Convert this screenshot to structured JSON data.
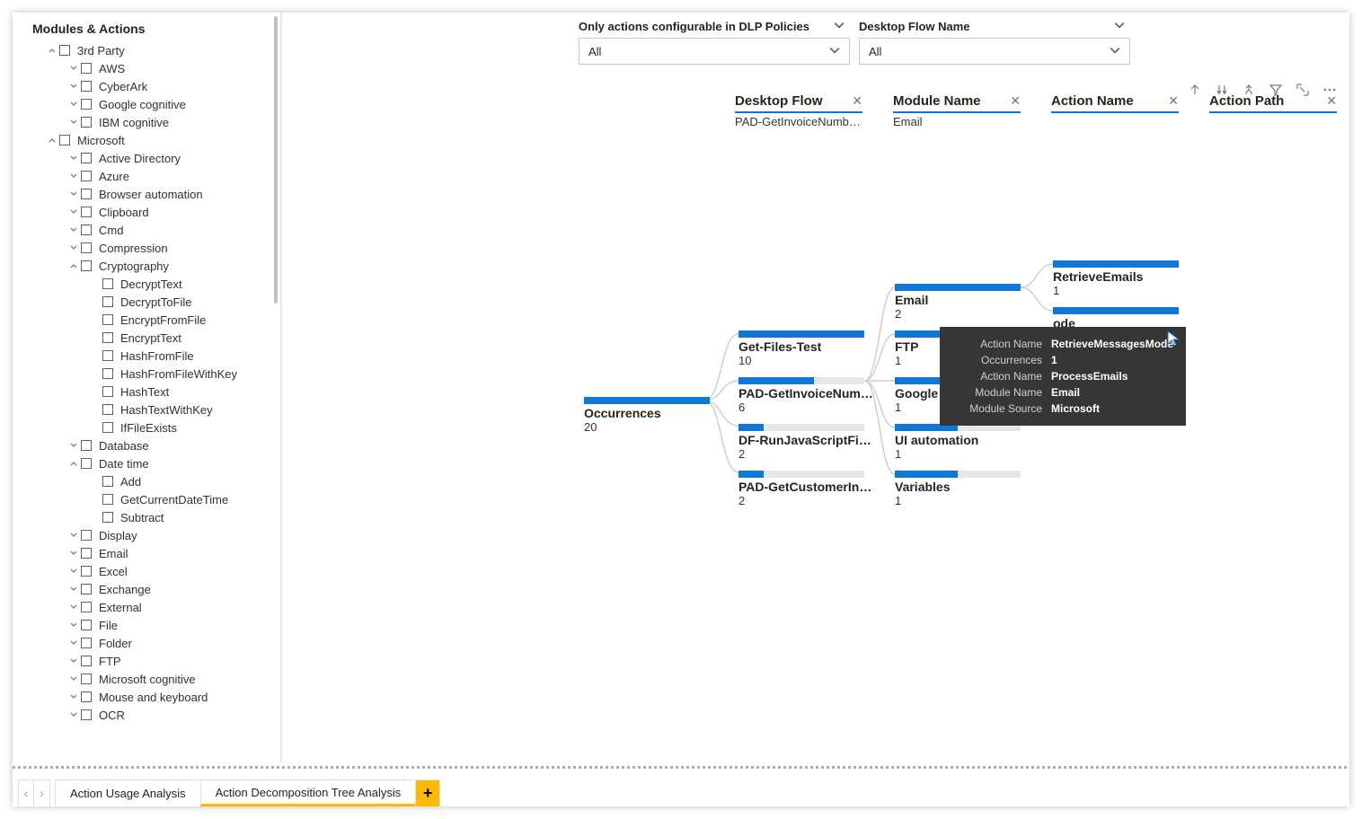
{
  "panel_title": "Modules & Actions",
  "tree": [
    {
      "lvl": 0,
      "exp": "open",
      "label": "3rd Party"
    },
    {
      "lvl": 1,
      "exp": "closed",
      "label": "AWS"
    },
    {
      "lvl": 1,
      "exp": "closed",
      "label": "CyberArk"
    },
    {
      "lvl": 1,
      "exp": "closed",
      "label": "Google cognitive"
    },
    {
      "lvl": 1,
      "exp": "closed",
      "label": "IBM cognitive"
    },
    {
      "lvl": 0,
      "exp": "open",
      "label": "Microsoft"
    },
    {
      "lvl": 1,
      "exp": "closed",
      "label": "Active Directory"
    },
    {
      "lvl": 1,
      "exp": "closed",
      "label": "Azure"
    },
    {
      "lvl": 1,
      "exp": "closed",
      "label": "Browser automation"
    },
    {
      "lvl": 1,
      "exp": "closed",
      "label": "Clipboard"
    },
    {
      "lvl": 1,
      "exp": "closed",
      "label": "Cmd"
    },
    {
      "lvl": 1,
      "exp": "closed",
      "label": "Compression"
    },
    {
      "lvl": 1,
      "exp": "open",
      "label": "Cryptography"
    },
    {
      "lvl": 2,
      "exp": "none",
      "label": "DecryptText"
    },
    {
      "lvl": 2,
      "exp": "none",
      "label": "DecryptToFile"
    },
    {
      "lvl": 2,
      "exp": "none",
      "label": "EncryptFromFile"
    },
    {
      "lvl": 2,
      "exp": "none",
      "label": "EncryptText"
    },
    {
      "lvl": 2,
      "exp": "none",
      "label": "HashFromFile"
    },
    {
      "lvl": 2,
      "exp": "none",
      "label": "HashFromFileWithKey"
    },
    {
      "lvl": 2,
      "exp": "none",
      "label": "HashText"
    },
    {
      "lvl": 2,
      "exp": "none",
      "label": "HashTextWithKey"
    },
    {
      "lvl": 2,
      "exp": "none",
      "label": "IfFileExists"
    },
    {
      "lvl": 1,
      "exp": "closed",
      "label": "Database"
    },
    {
      "lvl": 1,
      "exp": "open",
      "label": "Date time"
    },
    {
      "lvl": 2,
      "exp": "none",
      "label": "Add"
    },
    {
      "lvl": 2,
      "exp": "none",
      "label": "GetCurrentDateTime"
    },
    {
      "lvl": 2,
      "exp": "none",
      "label": "Subtract"
    },
    {
      "lvl": 1,
      "exp": "closed",
      "label": "Display"
    },
    {
      "lvl": 1,
      "exp": "closed",
      "label": "Email"
    },
    {
      "lvl": 1,
      "exp": "closed",
      "label": "Excel"
    },
    {
      "lvl": 1,
      "exp": "closed",
      "label": "Exchange"
    },
    {
      "lvl": 1,
      "exp": "closed",
      "label": "External"
    },
    {
      "lvl": 1,
      "exp": "closed",
      "label": "File"
    },
    {
      "lvl": 1,
      "exp": "closed",
      "label": "Folder"
    },
    {
      "lvl": 1,
      "exp": "closed",
      "label": "FTP"
    },
    {
      "lvl": 1,
      "exp": "closed",
      "label": "Microsoft cognitive"
    },
    {
      "lvl": 1,
      "exp": "closed",
      "label": "Mouse and keyboard"
    },
    {
      "lvl": 1,
      "exp": "closed",
      "label": "OCR"
    }
  ],
  "filters": [
    {
      "label": "Only actions configurable in DLP Policies",
      "value": "All"
    },
    {
      "label": "Desktop Flow Name",
      "value": "All"
    }
  ],
  "breadcrumbs": [
    {
      "title": "Desktop Flow",
      "sub": "PAD-GetInvoiceNumb…"
    },
    {
      "title": "Module Name",
      "sub": "Email"
    },
    {
      "title": "Action Name",
      "sub": ""
    },
    {
      "title": "Action Path",
      "sub": ""
    }
  ],
  "nodes": {
    "root": {
      "label": "Occurrences",
      "value": "20"
    },
    "c1": [
      {
        "label": "Get-Files-Test",
        "value": "10",
        "frac": 1.0
      },
      {
        "label": "PAD-GetInvoiceNum…",
        "value": "6",
        "frac": 0.6,
        "selected": true
      },
      {
        "label": "DF-RunJavaScriptFiles",
        "value": "2",
        "frac": 0.2
      },
      {
        "label": "PAD-GetCustomerInfo…",
        "value": "2",
        "frac": 0.2
      }
    ],
    "c2": [
      {
        "label": "Email",
        "value": "2",
        "frac": 1.0,
        "selected": true
      },
      {
        "label": "FTP",
        "value": "1",
        "frac": 0.5
      },
      {
        "label": "Google c",
        "value": "1",
        "frac": 0.5
      },
      {
        "label": "UI automation",
        "value": "1",
        "frac": 0.5
      },
      {
        "label": "Variables",
        "value": "1",
        "frac": 0.5
      }
    ],
    "c3": [
      {
        "label": "RetrieveEmails",
        "value": "1",
        "frac": 1.0
      },
      {
        "label": "ode",
        "value": "1",
        "frac": 1.0
      }
    ]
  },
  "tooltip": {
    "rows": [
      {
        "k": "Action Name",
        "v": "RetrieveMessagesMode",
        "bold": true
      },
      {
        "k": "Occurrences",
        "v": "1",
        "bold": true
      },
      {
        "k": "Action Name",
        "v": "ProcessEmails",
        "bold": true
      },
      {
        "k": "Module Name",
        "v": "Email",
        "bold": true
      },
      {
        "k": "Module Source",
        "v": "Microsoft",
        "bold": true
      }
    ]
  },
  "tabs": {
    "items": [
      {
        "label": "Action Usage Analysis",
        "active": false
      },
      {
        "label": "Action Decomposition Tree Analysis",
        "active": true
      }
    ],
    "add": "+"
  },
  "icons": {
    "nav_prev": "‹",
    "nav_next": "›"
  }
}
